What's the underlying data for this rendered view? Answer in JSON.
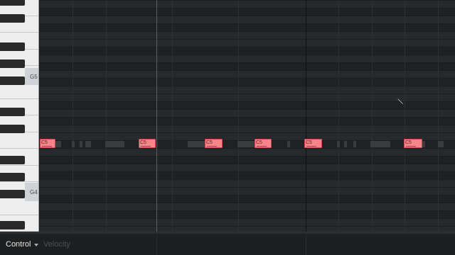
{
  "keyboard": {
    "label_g5": "G5",
    "label_g4": "G4"
  },
  "notes": [
    {
      "label": "C5"
    },
    {
      "label": "C5"
    },
    {
      "label": "C5"
    },
    {
      "label": "C5"
    },
    {
      "label": "C5"
    },
    {
      "label": "C5"
    }
  ],
  "control_bar": {
    "control_label": "Control",
    "parameter_label": "Velocity"
  },
  "colors": {
    "note_fill": "#f4858a",
    "note_border": "#c9454c",
    "background": "#232527"
  },
  "icons": {
    "cursor": "pencil-icon",
    "dropdown": "chevron-down-icon"
  }
}
